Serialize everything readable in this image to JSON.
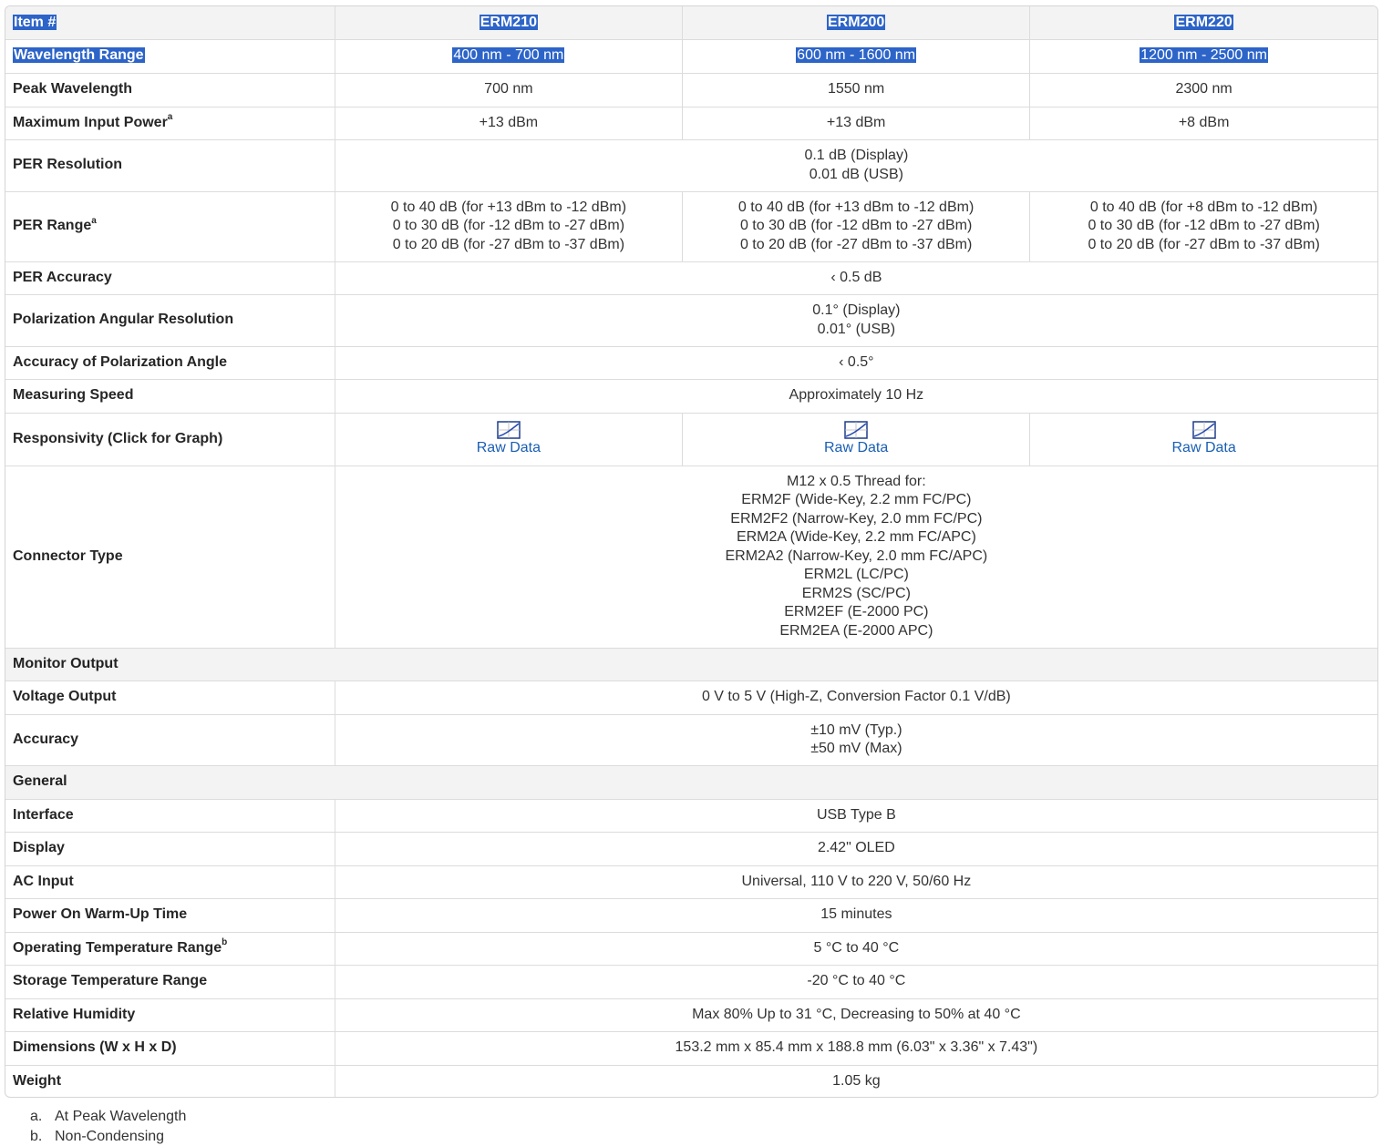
{
  "header": {
    "label": "Item #",
    "models": [
      "ERM210",
      "ERM200",
      "ERM220"
    ]
  },
  "rows": {
    "wavelength_range": {
      "label": "Wavelength Range",
      "values": [
        "400 nm - 700 nm",
        "600 nm - 1600 nm",
        "1200 nm - 2500 nm"
      ]
    },
    "peak_wavelength": {
      "label": "Peak Wavelength",
      "values": [
        "700 nm",
        "1550 nm",
        "2300 nm"
      ]
    },
    "max_input_power": {
      "label": "Maximum Input Power",
      "sup": "a",
      "values": [
        "+13 dBm",
        "+13 dBm",
        "+8 dBm"
      ]
    },
    "per_resolution": {
      "label": "PER Resolution",
      "lines": [
        "0.1 dB (Display)",
        "0.01 dB (USB)"
      ]
    },
    "per_range": {
      "label": "PER Range",
      "sup": "a",
      "erm210": [
        "0 to 40 dB (for +13 dBm to -12 dBm)",
        "0 to 30 dB (for -12 dBm to -27 dBm)",
        "0 to 20 dB (for -27 dBm to -37 dBm)"
      ],
      "erm200": [
        "0 to 40 dB (for +13 dBm to -12 dBm)",
        "0 to 30 dB (for -12 dBm to -27 dBm)",
        "0 to 20 dB (for -27 dBm to -37 dBm)"
      ],
      "erm220": [
        "0 to 40 dB (for +8 dBm to -12 dBm)",
        "0 to 30 dB (for -12 dBm to -27 dBm)",
        "0 to 20 dB (for -27 dBm to -37 dBm)"
      ]
    },
    "per_accuracy": {
      "label": "PER Accuracy",
      "value": "‹ 0.5 dB"
    },
    "pol_ang_res": {
      "label": "Polarization Angular Resolution",
      "lines": [
        "0.1° (Display)",
        "0.01° (USB)"
      ]
    },
    "pol_ang_acc": {
      "label": "Accuracy of Polarization Angle",
      "value": "‹ 0.5°"
    },
    "measuring_speed": {
      "label": "Measuring Speed",
      "value": "Approximately 10 Hz"
    },
    "responsivity": {
      "label": "Responsivity (Click for Graph)",
      "link_label": "Raw Data",
      "icon": "graph-icon"
    },
    "connector_type": {
      "label": "Connector Type",
      "lines": [
        "M12 x 0.5 Thread for:",
        "ERM2F (Wide-Key, 2.2 mm FC/PC)",
        "ERM2F2 (Narrow-Key, 2.0 mm FC/PC)",
        "ERM2A (Wide-Key, 2.2 mm FC/APC)",
        "ERM2A2 (Narrow-Key, 2.0 mm FC/APC)",
        "ERM2L (LC/PC)",
        "ERM2S (SC/PC)",
        "ERM2EF (E-2000 PC)",
        "ERM2EA (E-2000 APC)"
      ]
    },
    "monitor_output": {
      "label": "Monitor Output"
    },
    "voltage_output": {
      "label": "Voltage Output",
      "value": "0 V to 5 V (High-Z, Conversion Factor 0.1 V/dB)"
    },
    "accuracy": {
      "label": "Accuracy",
      "lines": [
        "±10 mV (Typ.)",
        "±50 mV (Max)"
      ]
    },
    "general": {
      "label": "General"
    },
    "interface": {
      "label": "Interface",
      "value": "USB Type B"
    },
    "display": {
      "label": "Display",
      "value": "2.42\" OLED"
    },
    "ac_input": {
      "label": "AC Input",
      "value": "Universal, 110 V to 220 V, 50/60 Hz"
    },
    "warmup": {
      "label": "Power On Warm-Up Time",
      "value": "15 minutes"
    },
    "op_temp": {
      "label": "Operating Temperature Range",
      "sup": "b",
      "value": "5 °C to 40 °C"
    },
    "storage_temp": {
      "label": "Storage Temperature Range",
      "value": "-20 °C to 40 °C"
    },
    "humidity": {
      "label": "Relative Humidity",
      "value": "Max 80% Up to 31 °C, Decreasing to 50% at 40 °C"
    },
    "dimensions": {
      "label": "Dimensions (W x H x D)",
      "value": "153.2 mm x 85.4 mm x 188.8 mm (6.03\" x 3.36\" x 7.43\")"
    },
    "weight": {
      "label": "Weight",
      "value": "1.05 kg"
    }
  },
  "footnotes": [
    {
      "key": "a.",
      "text": "At Peak Wavelength"
    },
    {
      "key": "b.",
      "text": "Non-Condensing"
    }
  ],
  "colors": {
    "highlight": "#2d64c8",
    "link": "#1a5fb4",
    "header_bg": "#f3f3f3",
    "border": "#dcdcdc"
  }
}
